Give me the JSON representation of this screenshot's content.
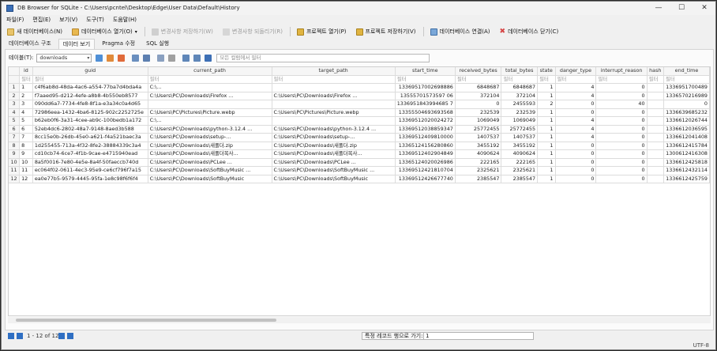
{
  "window": {
    "title": "DB Browser for SQLite - C:\\Users\\pcntel\\Desktop\\Edge\\User Data\\Default\\History",
    "minimize": "—",
    "maximize": "☐",
    "close": "✕"
  },
  "menu": [
    "파일(F)",
    "편집(E)",
    "보기(V)",
    "도구(T)",
    "도움말(H)"
  ],
  "toolbar": {
    "new_db": "새 데이터베이스(N)",
    "open_db": "데이터베이스 열기(O)",
    "write_changes": "변경사항 저장하기(W)",
    "revert_changes": "변경사항 되돌리기(R)",
    "open_project": "프로젝트 열기(P)",
    "save_project": "프로젝트 저장하기(V)",
    "attach_db": "데이터베이스 연결(A)",
    "close_db": "데이터베이스 닫기(C)"
  },
  "tabs": [
    {
      "label": "데이터베이스 구조",
      "active": false
    },
    {
      "label": "데이터 보기",
      "active": true
    },
    {
      "label": "Pragma 수정",
      "active": false
    },
    {
      "label": "SQL 실행",
      "active": false
    }
  ],
  "table_bar": {
    "label": "테이블(T):",
    "selected_table": "downloads",
    "filter_placeholder": "모든 컬럼에서 필터"
  },
  "grid": {
    "columns": [
      "id",
      "guid",
      "current_path",
      "target_path",
      "start_time",
      "received_bytes",
      "total_bytes",
      "state",
      "danger_type",
      "interrupt_reason",
      "hash",
      "end_time"
    ],
    "filter_placeholder": "필터",
    "rows": [
      [
        "1",
        "1",
        "c4f6ab8d-48da-4ac6-a554-77ba7d4bda4a",
        "C:\\...",
        "",
        "13369517002698886",
        "6848687",
        "6848687",
        "1",
        "4",
        "0",
        "",
        "1336951700489"
      ],
      [
        "2",
        "2",
        "f7aaed95-d212-4efe-a8b8-4b550eb8577",
        "C:\\Users\\PC\\Downloads\\Firefox ...",
        "C:\\Users\\PC\\Downloads\\Firefox ...",
        "13555701573597 06",
        "372104",
        "372104",
        "1",
        "4",
        "0",
        "",
        "1336570216989"
      ],
      [
        "3",
        "3",
        "090dd6a7-7734-4fe8-8f1a-e3a34c0a4d65",
        "",
        "",
        "1336951843994685 7",
        "0",
        "2455593",
        "2",
        "0",
        "40",
        "",
        "0"
      ],
      [
        "4",
        "4",
        "72986eea-1432-4ba6-8125-902c2252725e",
        "C:\\Users\\PC\\Pictures\\Picture.webp",
        "C:\\Users\\PC\\Pictures\\Picture.webp",
        "13355504693693568",
        "232539",
        "232539",
        "1",
        "0",
        "0",
        "",
        "1336639685232"
      ],
      [
        "5",
        "5",
        "b62eb0f6-3a31-4cee-ab9c-100bedb1a172",
        "C:\\...",
        "",
        "13369512020024272",
        "1069049",
        "1069049",
        "1",
        "4",
        "0",
        "",
        "1336612026744"
      ],
      [
        "6",
        "6",
        "52eb4dc6-2802-48a7-9148-8aed3b588",
        "C:\\Users\\PC\\Downloads\\python-3.12.4 ...",
        "C:\\Users\\PC\\Downloads\\python-3.12.4 ...",
        "13369512038859347",
        "25772455",
        "25772455",
        "1",
        "4",
        "0",
        "",
        "1336612036595"
      ],
      [
        "7",
        "7",
        "8cc15e0b-26db-45e0-a621-f4a521baec3a",
        "C:\\Users\\PC\\Downloads\\setup-...",
        "C:\\Users\\PC\\Downloads\\setup-...",
        "13369512409810000",
        "1407537",
        "1407537",
        "1",
        "4",
        "0",
        "",
        "1336612041408"
      ],
      [
        "8",
        "8",
        "1d255455-713a-4f32-8fe2-38884339c3a4",
        "C:\\Users\\PC\\Downloads\\새폴더.zip",
        "C:\\Users\\PC\\Downloads\\새폴더.zip",
        "13365124156280860",
        "3455192",
        "3455192",
        "1",
        "0",
        "0",
        "",
        "1336612415784"
      ],
      [
        "9",
        "9",
        "cd10cb74-6ce7-4f1b-9cae-e4715940ead",
        "C:\\Users\\PC\\Downloads\\새폴더복사...",
        "C:\\Users\\PC\\Downloads\\새폴더복사...",
        "13369512402904849",
        "4090624",
        "4090624",
        "1",
        "0",
        "0",
        "",
        "1300612416308"
      ],
      [
        "10",
        "10",
        "8a5f0016-7e80-4e5e-8a4f-50faeccb740d",
        "C:\\Users\\PC\\Downloads\\PCLee ...",
        "C:\\Users\\PC\\Downloads\\PCLee ...",
        "13365124020026986",
        "222165",
        "222165",
        "1",
        "0",
        "0",
        "",
        "1336612425818"
      ],
      [
        "11",
        "11",
        "ec064f02-0611-4ec3-95e9-ce6cf796f7a15",
        "C:\\Users\\PC\\Downloads\\SoftBuyMusic ...",
        "C:\\Users\\PC\\Downloads\\SoftBuyMusic ...",
        "13369512421810704",
        "2325621",
        "2325621",
        "1",
        "0",
        "0",
        "",
        "1336612432114"
      ],
      [
        "12",
        "12",
        "ea0e77b5-9579-4445-95fa-1e8c98f6f6f4",
        "C:\\Users\\PC\\Downloads\\SoftBuyMusic",
        "C:\\Users\\PC\\Downloads\\SoftBuyMusic",
        "13369512426677740",
        "2385547",
        "2385547",
        "1",
        "0",
        "0",
        "",
        "1336612425759"
      ]
    ]
  },
  "pagination": {
    "info": "1 - 12 of 12",
    "goto_label": "특정 레코드 행으로 가기:",
    "goto_value": "1"
  },
  "status": {
    "encoding": "UTF-8"
  },
  "colors": {
    "accent": "#2f6fc3",
    "danger": "#d64545"
  }
}
